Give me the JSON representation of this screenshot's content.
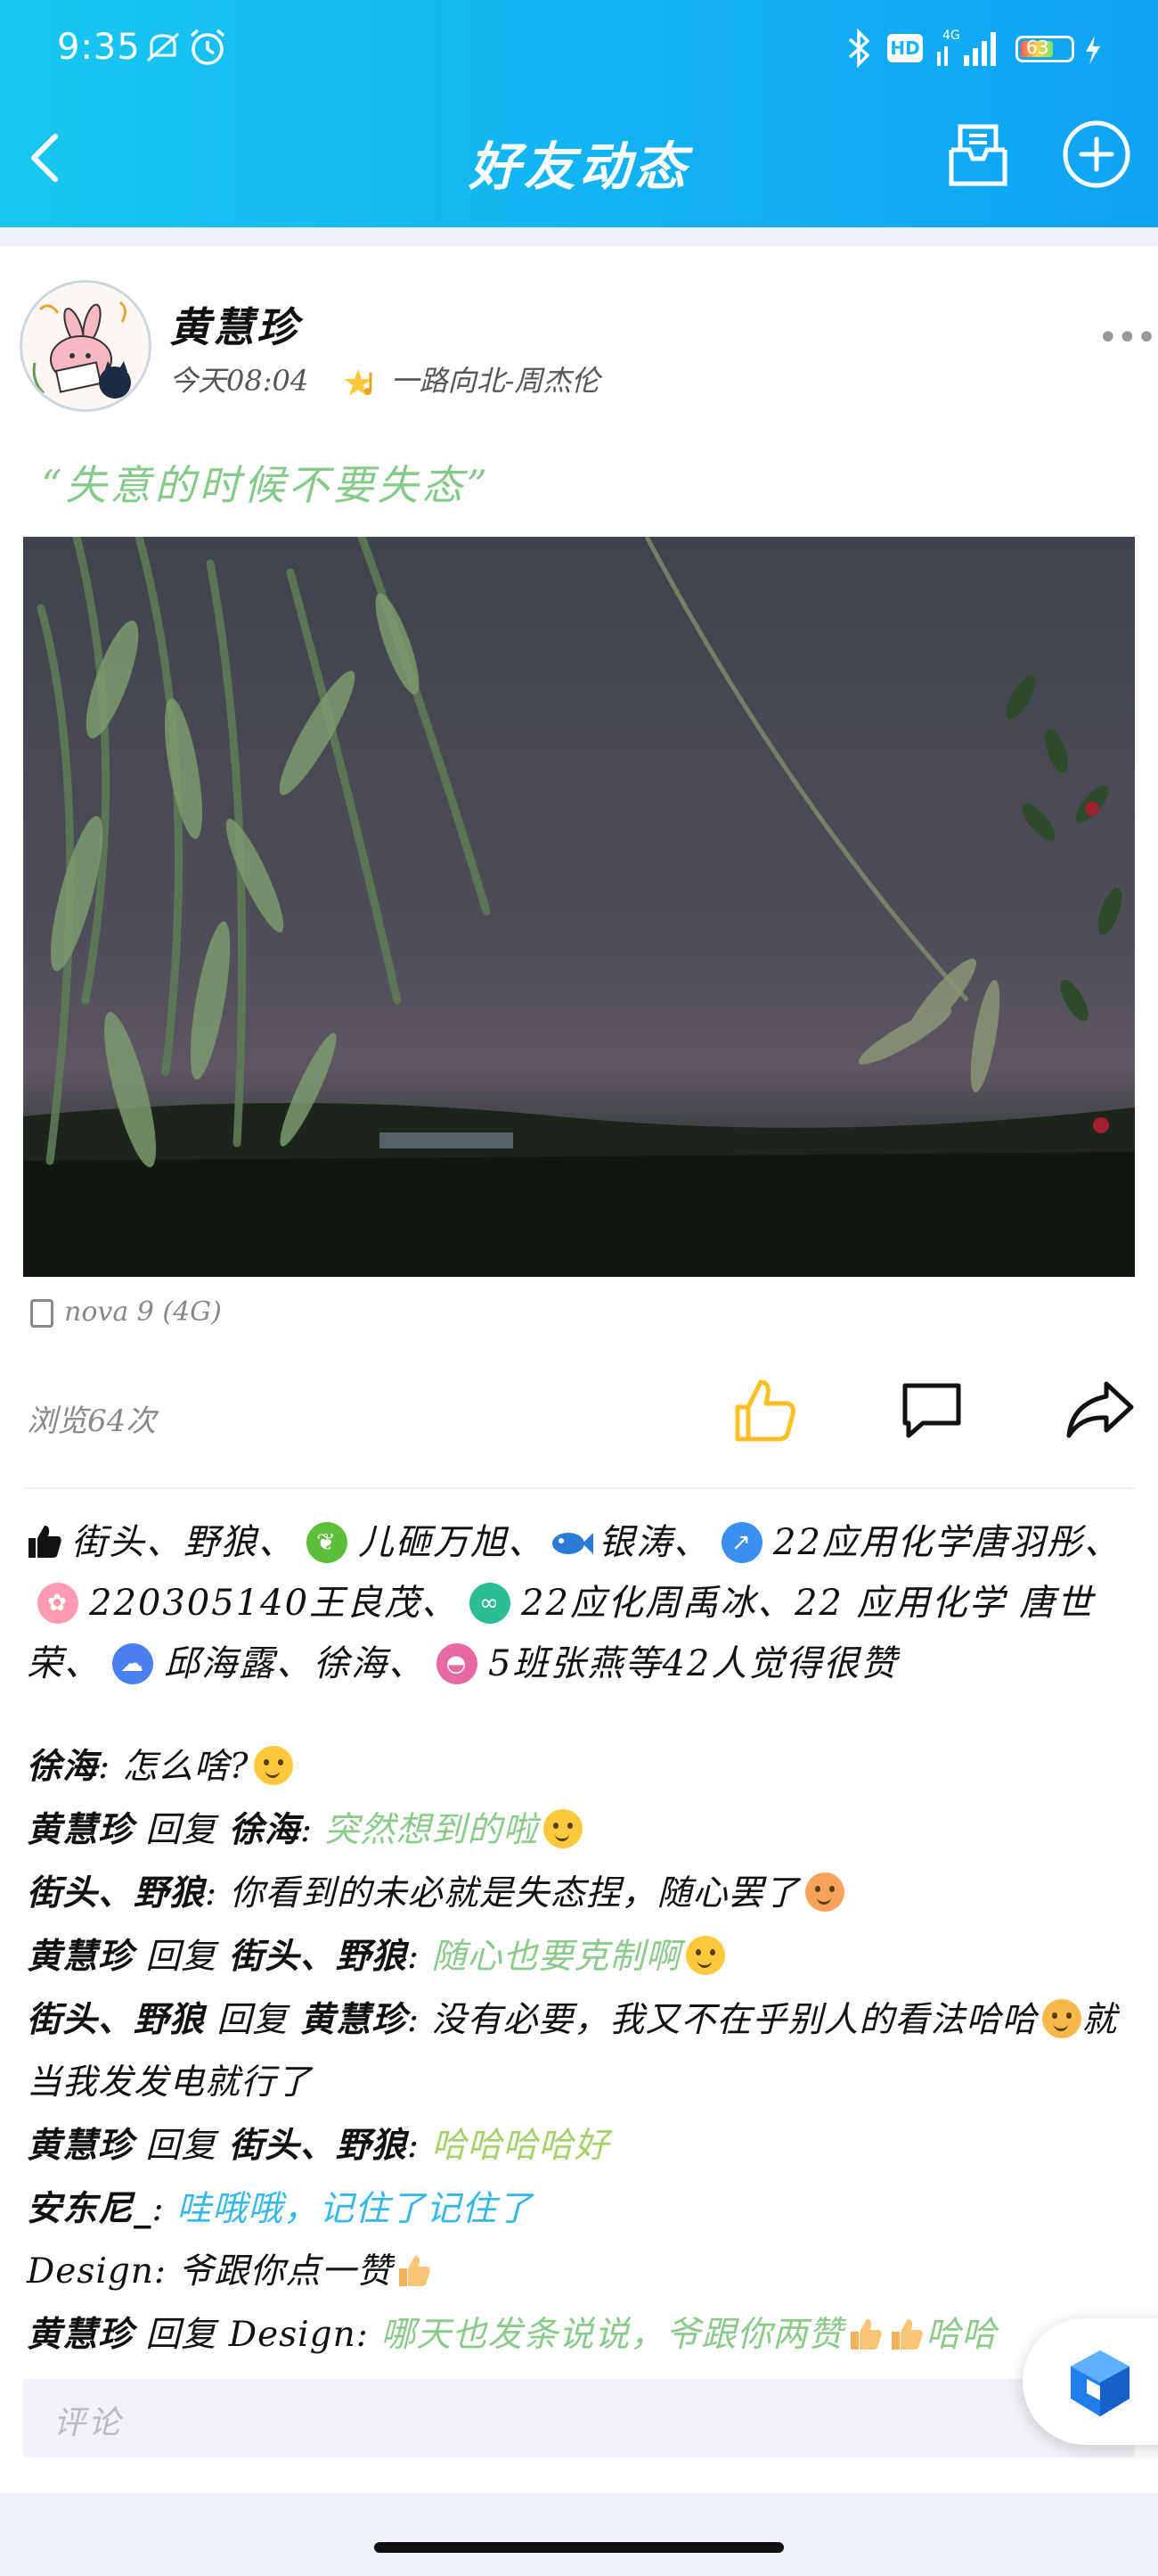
{
  "status_bar": {
    "time": "9:35",
    "hd_badge": "HD",
    "network": "4G",
    "battery": "63"
  },
  "nav": {
    "title": "好友动态"
  },
  "post": {
    "author": "黄慧珍",
    "time": "今天08:04",
    "music": "一路向北-周杰伦",
    "quote": "“失意的时候不要失态”",
    "device": "nova 9 (4G)",
    "views": "浏览64次"
  },
  "likes": {
    "seg1": "街头、野狼、",
    "seg2": "儿砸万旭、",
    "seg3": "银涛、",
    "seg4": "22应用化学唐羽彤、",
    "seg5": "220305140王良茂、",
    "seg6": "22应化周禹冰、22 应用化学 唐世荣、",
    "seg7": "邱海露、徐海、",
    "seg8": "5班张燕等42人觉得很赞"
  },
  "comments": [
    {
      "from": "徐海",
      "sep": ": ",
      "text": "怎么啥?"
    },
    {
      "from": "黄慧珍",
      "reply": " 回复 ",
      "to": "徐海",
      "sep": ": ",
      "text": "突然想到的啦"
    },
    {
      "from": "街头、野狼",
      "sep": ": ",
      "text": "你看到的未必就是失态捏，随心罢了"
    },
    {
      "from": "黄慧珍",
      "reply": " 回复 ",
      "to": "街头、野狼",
      "sep": ": ",
      "text": "随心也要克制啊"
    },
    {
      "from": "街头、野狼",
      "reply": " 回复 ",
      "to": "黄慧珍",
      "sep": ": ",
      "text": "没有必要，我又不在乎别人的看法哈哈",
      "text2": "就当我发发电就行了"
    },
    {
      "from": "黄慧珍",
      "reply": " 回复 ",
      "to": "街头、野狼",
      "sep": ": ",
      "text": "哈哈哈哈好"
    },
    {
      "from": "安东尼_",
      "sep": ": ",
      "text": "哇哦哦，记住了记住了"
    },
    {
      "from": "Design",
      "sep": ": ",
      "text": "爷跟你点一赞"
    },
    {
      "from": "黄慧珍",
      "reply": " 回复 ",
      "to": "Design",
      "sep": ": ",
      "text": "哪天也发条说说，爷跟你两赞",
      "text2": "哈哈"
    }
  ],
  "comment_input": {
    "placeholder": "评论"
  },
  "colors": {
    "header": "#12b2f3",
    "green_text": "#8cc98c",
    "blue_text": "#36b7e8",
    "like_yellow": "#ffc83d"
  },
  "icons": [
    "back-icon",
    "inbox-icon",
    "add-icon",
    "more-icon",
    "like-icon",
    "comment-icon",
    "share-icon",
    "phone-icon",
    "music-star-icon",
    "fab-cube-icon"
  ]
}
